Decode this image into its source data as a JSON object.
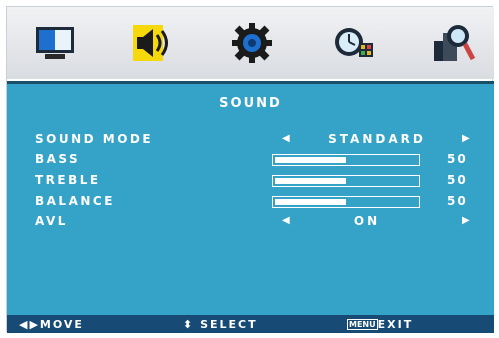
{
  "menu_tabs": [
    {
      "icon": "picture-icon",
      "active": false
    },
    {
      "icon": "sound-icon",
      "active": true
    },
    {
      "icon": "gear-icon",
      "active": false
    },
    {
      "icon": "clock-icon",
      "active": false
    },
    {
      "icon": "magnifier-icon",
      "active": false
    }
  ],
  "panel": {
    "title": "SOUND",
    "sound_mode": {
      "label": "SOUND MODE",
      "value": "STANDARD"
    },
    "bass": {
      "label": "BASS",
      "value": "50",
      "level": 50
    },
    "treble": {
      "label": "TREBLE",
      "value": "50",
      "level": 50
    },
    "balance": {
      "label": "BALANCE",
      "value": "50",
      "level": 50
    },
    "avl": {
      "label": "AVL",
      "value": "ON"
    }
  },
  "footer": {
    "move": "MOVE",
    "select": "SELECT",
    "menu_key": "MENU",
    "exit": "EXIT"
  },
  "colors": {
    "panel_bg": "#35a3c8",
    "footer_bg": "#174a74",
    "active_tab": "#f5d90a"
  }
}
